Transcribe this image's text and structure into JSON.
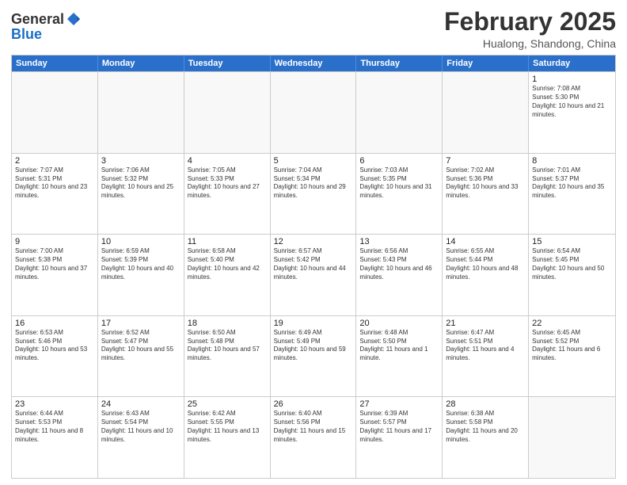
{
  "logo": {
    "general": "General",
    "blue": "Blue",
    "icon_color": "#2a6fc9"
  },
  "header": {
    "title": "February 2025",
    "subtitle": "Hualong, Shandong, China"
  },
  "weekdays": [
    "Sunday",
    "Monday",
    "Tuesday",
    "Wednesday",
    "Thursday",
    "Friday",
    "Saturday"
  ],
  "rows": [
    [
      {
        "day": "",
        "info": ""
      },
      {
        "day": "",
        "info": ""
      },
      {
        "day": "",
        "info": ""
      },
      {
        "day": "",
        "info": ""
      },
      {
        "day": "",
        "info": ""
      },
      {
        "day": "",
        "info": ""
      },
      {
        "day": "1",
        "info": "Sunrise: 7:08 AM\nSunset: 5:30 PM\nDaylight: 10 hours and 21 minutes."
      }
    ],
    [
      {
        "day": "2",
        "info": "Sunrise: 7:07 AM\nSunset: 5:31 PM\nDaylight: 10 hours and 23 minutes."
      },
      {
        "day": "3",
        "info": "Sunrise: 7:06 AM\nSunset: 5:32 PM\nDaylight: 10 hours and 25 minutes."
      },
      {
        "day": "4",
        "info": "Sunrise: 7:05 AM\nSunset: 5:33 PM\nDaylight: 10 hours and 27 minutes."
      },
      {
        "day": "5",
        "info": "Sunrise: 7:04 AM\nSunset: 5:34 PM\nDaylight: 10 hours and 29 minutes."
      },
      {
        "day": "6",
        "info": "Sunrise: 7:03 AM\nSunset: 5:35 PM\nDaylight: 10 hours and 31 minutes."
      },
      {
        "day": "7",
        "info": "Sunrise: 7:02 AM\nSunset: 5:36 PM\nDaylight: 10 hours and 33 minutes."
      },
      {
        "day": "8",
        "info": "Sunrise: 7:01 AM\nSunset: 5:37 PM\nDaylight: 10 hours and 35 minutes."
      }
    ],
    [
      {
        "day": "9",
        "info": "Sunrise: 7:00 AM\nSunset: 5:38 PM\nDaylight: 10 hours and 37 minutes."
      },
      {
        "day": "10",
        "info": "Sunrise: 6:59 AM\nSunset: 5:39 PM\nDaylight: 10 hours and 40 minutes."
      },
      {
        "day": "11",
        "info": "Sunrise: 6:58 AM\nSunset: 5:40 PM\nDaylight: 10 hours and 42 minutes."
      },
      {
        "day": "12",
        "info": "Sunrise: 6:57 AM\nSunset: 5:42 PM\nDaylight: 10 hours and 44 minutes."
      },
      {
        "day": "13",
        "info": "Sunrise: 6:56 AM\nSunset: 5:43 PM\nDaylight: 10 hours and 46 minutes."
      },
      {
        "day": "14",
        "info": "Sunrise: 6:55 AM\nSunset: 5:44 PM\nDaylight: 10 hours and 48 minutes."
      },
      {
        "day": "15",
        "info": "Sunrise: 6:54 AM\nSunset: 5:45 PM\nDaylight: 10 hours and 50 minutes."
      }
    ],
    [
      {
        "day": "16",
        "info": "Sunrise: 6:53 AM\nSunset: 5:46 PM\nDaylight: 10 hours and 53 minutes."
      },
      {
        "day": "17",
        "info": "Sunrise: 6:52 AM\nSunset: 5:47 PM\nDaylight: 10 hours and 55 minutes."
      },
      {
        "day": "18",
        "info": "Sunrise: 6:50 AM\nSunset: 5:48 PM\nDaylight: 10 hours and 57 minutes."
      },
      {
        "day": "19",
        "info": "Sunrise: 6:49 AM\nSunset: 5:49 PM\nDaylight: 10 hours and 59 minutes."
      },
      {
        "day": "20",
        "info": "Sunrise: 6:48 AM\nSunset: 5:50 PM\nDaylight: 11 hours and 1 minute."
      },
      {
        "day": "21",
        "info": "Sunrise: 6:47 AM\nSunset: 5:51 PM\nDaylight: 11 hours and 4 minutes."
      },
      {
        "day": "22",
        "info": "Sunrise: 6:45 AM\nSunset: 5:52 PM\nDaylight: 11 hours and 6 minutes."
      }
    ],
    [
      {
        "day": "23",
        "info": "Sunrise: 6:44 AM\nSunset: 5:53 PM\nDaylight: 11 hours and 8 minutes."
      },
      {
        "day": "24",
        "info": "Sunrise: 6:43 AM\nSunset: 5:54 PM\nDaylight: 11 hours and 10 minutes."
      },
      {
        "day": "25",
        "info": "Sunrise: 6:42 AM\nSunset: 5:55 PM\nDaylight: 11 hours and 13 minutes."
      },
      {
        "day": "26",
        "info": "Sunrise: 6:40 AM\nSunset: 5:56 PM\nDaylight: 11 hours and 15 minutes."
      },
      {
        "day": "27",
        "info": "Sunrise: 6:39 AM\nSunset: 5:57 PM\nDaylight: 11 hours and 17 minutes."
      },
      {
        "day": "28",
        "info": "Sunrise: 6:38 AM\nSunset: 5:58 PM\nDaylight: 11 hours and 20 minutes."
      },
      {
        "day": "",
        "info": ""
      }
    ]
  ]
}
